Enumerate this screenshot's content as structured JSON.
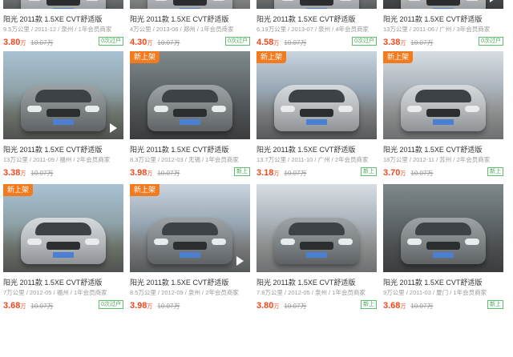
{
  "listings": [
    {
      "badge": "",
      "video": false,
      "title": "阳光 2011款 1.5XE CVT舒适版",
      "meta": "9.5万公里 / 2011-12 / 泉州 / 1年会员商家",
      "price": "3.80",
      "unit": "万",
      "orig": "10.07万",
      "tag": "0次过户"
    },
    {
      "badge": "",
      "video": false,
      "title": "阳光 2011款 1.5XE CVT舒适版",
      "meta": "4万公里 / 2013-06 / 郑州 / 1年会员商家",
      "price": "4.30",
      "unit": "万",
      "orig": "10.07万",
      "tag": "0次过户"
    },
    {
      "badge": "",
      "video": false,
      "title": "阳光 2011款 1.5XE CVT舒适版",
      "meta": "6.19万公里 / 2013-07 / 泉州 / 4年会员商家",
      "price": "4.58",
      "unit": "万",
      "orig": "10.07万",
      "tag": "0次过户"
    },
    {
      "badge": "",
      "video": true,
      "title": "阳光 2011款 1.5XE CVT舒适版",
      "meta": "13万公里 / 2011-06 / 广州 / 3年会员商家",
      "price": "3.38",
      "unit": "万",
      "orig": "10.07万",
      "tag": "0次过户"
    },
    {
      "badge": "",
      "video": true,
      "title": "阳光 2011款 1.5XE CVT舒适版",
      "meta": "13万公里 / 2011-09 / 福州 / 2年会员商家",
      "price": "3.38",
      "unit": "万",
      "orig": "10.07万",
      "tag": ""
    },
    {
      "badge": "新上架",
      "video": false,
      "title": "阳光 2011款 1.5XE CVT舒适版",
      "meta": "8.3万公里 / 2012-03 / 无锡 / 1年会员商家",
      "price": "3.98",
      "unit": "万",
      "orig": "10.07万",
      "tag": "新上"
    },
    {
      "badge": "新上架",
      "video": false,
      "title": "阳光 2011款 1.5XE CVT舒适版",
      "meta": "13.7万公里 / 2011-10 / 广州 / 2年会员商家",
      "price": "3.18",
      "unit": "万",
      "orig": "10.07万",
      "tag": "新上"
    },
    {
      "badge": "新上架",
      "video": false,
      "title": "阳光 2011款 1.5XE CVT舒适版",
      "meta": "18万公里 / 2012-11 / 苏州 / 2年会员商家",
      "price": "3.70",
      "unit": "万",
      "orig": "10.07万",
      "tag": "新上"
    },
    {
      "badge": "新上架",
      "video": false,
      "title": "阳光 2011款 1.5XE CVT舒适版",
      "meta": "7万公里 / 2012-05 / 福州 / 1年会员商家",
      "price": "3.68",
      "unit": "万",
      "orig": "10.07万",
      "tag": "0次过户"
    },
    {
      "badge": "新上架",
      "video": true,
      "title": "阳光 2011款 1.5XE CVT舒适版",
      "meta": "8.5万公里 / 2012-09 / 泉州 / 2年会员商家",
      "price": "3.98",
      "unit": "万",
      "orig": "10.07万",
      "tag": ""
    },
    {
      "badge": "",
      "video": false,
      "title": "阳光 2011款 1.5XE CVT舒适版",
      "meta": "7.8万公里 / 2012-05 / 泉州 / 1年会员商家",
      "price": "3.80",
      "unit": "万",
      "orig": "10.07万",
      "tag": "新上"
    },
    {
      "badge": "",
      "video": false,
      "title": "阳光 2011款 1.5XE CVT舒适版",
      "meta": "9万公里 / 2011-03 / 厦门 / 1年会员商家",
      "price": "3.68",
      "unit": "万",
      "orig": "10.07万",
      "tag": "新上"
    }
  ]
}
